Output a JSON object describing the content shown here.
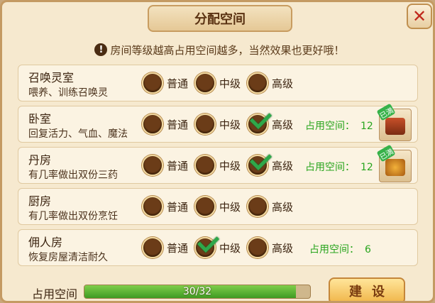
{
  "dialog": {
    "title": "分配空间",
    "close_label": "✕",
    "notice": "房间等级越高占用空间越多，当然效果也更好哦！",
    "notice_icon": "!"
  },
  "options": {
    "normal": "普通",
    "medium": "中级",
    "high": "高级"
  },
  "space_label": "占用空间：",
  "rooms": [
    {
      "name": "召唤灵室",
      "desc": "喂养、训练召唤灵",
      "selected": null,
      "space": ""
    },
    {
      "name": "卧室",
      "desc": "回复活力、气血、魔法",
      "selected": "high",
      "space": "12",
      "badge": "已満"
    },
    {
      "name": "丹房",
      "desc": "有几率做出双份三药",
      "selected": "high",
      "space": "12",
      "badge": "已満"
    },
    {
      "name": "厨房",
      "desc": "有几率做出双份烹饪",
      "selected": null,
      "space": ""
    },
    {
      "name": "佣人房",
      "desc": "恢复房屋清洁耐久",
      "selected": "medium",
      "space": "6"
    }
  ],
  "footer": {
    "label": "占用空间",
    "progress_text": "30/32",
    "progress_fraction": 0.9375,
    "build_label": "建设"
  },
  "colors": {
    "accent_green": "#29a51e",
    "close_red": "#c0281c",
    "panel": "#f6e9cf"
  }
}
